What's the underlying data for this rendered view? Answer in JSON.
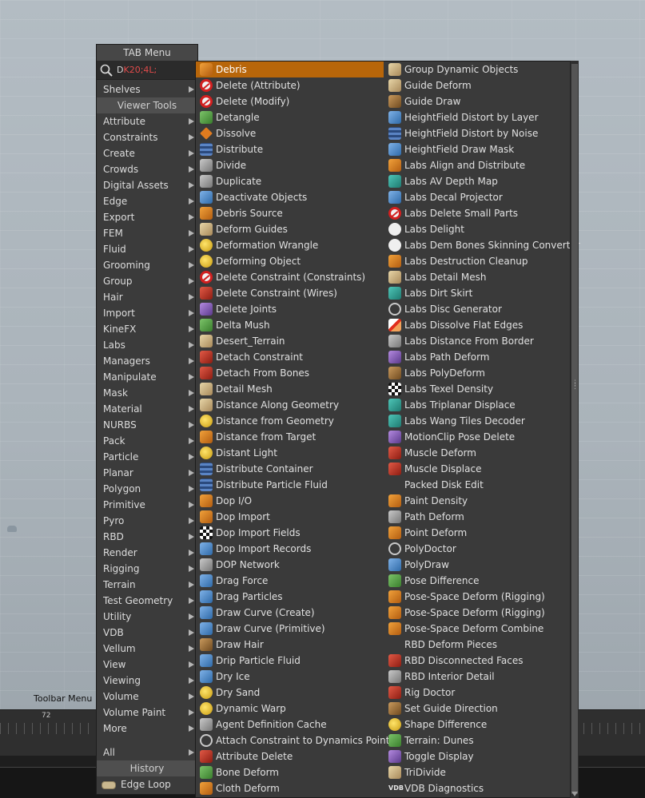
{
  "viewport": {
    "toolbar_menu_label": "Toolbar Menu",
    "frame_label": "72"
  },
  "tab_menu": {
    "title": "TAB Menu",
    "search": {
      "typed": "D",
      "hint": "K20;4L;"
    },
    "shelves_label": "Shelves",
    "viewer_tools_label": "Viewer Tools",
    "categories": [
      "Attribute",
      "Constraints",
      "Create",
      "Crowds",
      "Digital Assets",
      "Edge",
      "Export",
      "FEM",
      "Fluid",
      "Grooming",
      "Group",
      "Hair",
      "Import",
      "KineFX",
      "Labs",
      "Managers",
      "Manipulate",
      "Mask",
      "Material",
      "NURBS",
      "Pack",
      "Particle",
      "Planar",
      "Polygon",
      "Primitive",
      "Pyro",
      "RBD",
      "Render",
      "Rigging",
      "Terrain",
      "Test Geometry",
      "Utility",
      "VDB",
      "Vellum",
      "View",
      "Viewing",
      "Volume",
      "Volume Paint",
      "More"
    ],
    "all_label": "All",
    "history_label": "History",
    "history_items": [
      "Edge Loop"
    ]
  },
  "submenu": {
    "column1": [
      {
        "label": "Debris",
        "icon": "debris-icon",
        "style": "orange",
        "selected": true
      },
      {
        "label": "Delete (Attribute)",
        "icon": "no-entry-icon",
        "style": "noentry"
      },
      {
        "label": "Delete (Modify)",
        "icon": "no-entry-icon",
        "style": "noentry"
      },
      {
        "label": "Detangle",
        "icon": "detangle-icon",
        "style": "green"
      },
      {
        "label": "Dissolve",
        "icon": "dissolve-icon",
        "style": "diamond"
      },
      {
        "label": "Distribute",
        "icon": "distribute-icon",
        "style": "gridb"
      },
      {
        "label": "Divide",
        "icon": "divide-icon",
        "style": "grey"
      },
      {
        "label": "Duplicate",
        "icon": "duplicate-icon",
        "style": "grey"
      },
      {
        "label": "Deactivate Objects",
        "icon": "deactivate-objects-icon",
        "style": "blue"
      },
      {
        "label": "Debris Source",
        "icon": "debris-source-icon",
        "style": "orange"
      },
      {
        "label": "Deform Guides",
        "icon": "deform-guides-icon",
        "style": "tan"
      },
      {
        "label": "Deformation Wrangle",
        "icon": "wrangle-icon",
        "style": "yellow"
      },
      {
        "label": "Deforming Object",
        "icon": "deforming-object-icon",
        "style": "yellow"
      },
      {
        "label": "Delete Constraint (Constraints)",
        "icon": "no-entry-icon",
        "style": "noentry"
      },
      {
        "label": "Delete Constraint (Wires)",
        "icon": "delete-constraint-wires-icon",
        "style": "red"
      },
      {
        "label": "Delete Joints",
        "icon": "delete-joints-icon",
        "style": "purple"
      },
      {
        "label": "Delta Mush",
        "icon": "delta-mush-icon",
        "style": "green"
      },
      {
        "label": "Desert_Terrain",
        "icon": "desert-terrain-icon",
        "style": "tan"
      },
      {
        "label": "Detach Constraint",
        "icon": "detach-constraint-icon",
        "style": "red"
      },
      {
        "label": "Detach From Bones",
        "icon": "detach-from-bones-icon",
        "style": "red"
      },
      {
        "label": "Detail Mesh",
        "icon": "detail-mesh-icon",
        "style": "tan"
      },
      {
        "label": "Distance Along Geometry",
        "icon": "distance-along-geometry-icon",
        "style": "tan"
      },
      {
        "label": "Distance from Geometry",
        "icon": "distance-from-geometry-icon",
        "style": "yellow"
      },
      {
        "label": "Distance from Target",
        "icon": "distance-from-target-icon",
        "style": "orange"
      },
      {
        "label": "Distant Light",
        "icon": "distant-light-icon",
        "style": "yellow"
      },
      {
        "label": "Distribute Container",
        "icon": "distribute-container-icon",
        "style": "gridb"
      },
      {
        "label": "Distribute Particle Fluid",
        "icon": "distribute-particle-fluid-icon",
        "style": "gridb"
      },
      {
        "label": "Dop I/O",
        "icon": "dop-io-icon",
        "style": "orange"
      },
      {
        "label": "Dop Import",
        "icon": "dop-import-icon",
        "style": "orange"
      },
      {
        "label": "Dop Import Fields",
        "icon": "dop-import-fields-icon",
        "style": "checker"
      },
      {
        "label": "Dop Import Records",
        "icon": "dop-import-records-icon",
        "style": "blue"
      },
      {
        "label": "DOP Network",
        "icon": "dop-network-icon",
        "style": "grey"
      },
      {
        "label": "Drag Force",
        "icon": "drag-force-icon",
        "style": "blue"
      },
      {
        "label": "Drag Particles",
        "icon": "drag-particles-icon",
        "style": "blue"
      },
      {
        "label": "Draw Curve (Create)",
        "icon": "draw-curve-icon",
        "style": "blue"
      },
      {
        "label": "Draw Curve (Primitive)",
        "icon": "draw-curve-icon",
        "style": "blue"
      },
      {
        "label": "Draw Hair",
        "icon": "draw-hair-icon",
        "style": "brown"
      },
      {
        "label": "Drip Particle Fluid",
        "icon": "drip-particle-fluid-icon",
        "style": "blue"
      },
      {
        "label": "Dry Ice",
        "icon": "dry-ice-icon",
        "style": "blue"
      },
      {
        "label": "Dry Sand",
        "icon": "dry-sand-icon",
        "style": "yellow"
      },
      {
        "label": "Dynamic Warp",
        "icon": "dynamic-warp-icon",
        "style": "yellow"
      },
      {
        "label": "Agent Definition Cache",
        "icon": "agent-definition-cache-icon",
        "style": "grey"
      },
      {
        "label": "Attach Constraint to Dynamics Point",
        "icon": "attach-constraint-icon",
        "style": "ring"
      },
      {
        "label": "Attribute Delete",
        "icon": "attribute-delete-icon",
        "style": "red"
      },
      {
        "label": "Bone Deform",
        "icon": "bone-deform-icon",
        "style": "green"
      },
      {
        "label": "Cloth Deform",
        "icon": "cloth-deform-icon",
        "style": "orange"
      }
    ],
    "column2": [
      {
        "label": "Group Dynamic Objects",
        "icon": "group-dynamic-objects-icon",
        "style": "tan"
      },
      {
        "label": "Guide Deform",
        "icon": "guide-deform-icon",
        "style": "tan"
      },
      {
        "label": "Guide Draw",
        "icon": "guide-draw-icon",
        "style": "brown"
      },
      {
        "label": "HeightField Distort by Layer",
        "icon": "heightfield-distort-layer-icon",
        "style": "blue"
      },
      {
        "label": "HeightField Distort by Noise",
        "icon": "heightfield-distort-noise-icon",
        "style": "gridb"
      },
      {
        "label": "HeightField Draw Mask",
        "icon": "heightfield-draw-mask-icon",
        "style": "blue"
      },
      {
        "label": "Labs Align and Distribute",
        "icon": "labs-align-distribute-icon",
        "style": "orange"
      },
      {
        "label": "Labs AV Depth Map",
        "icon": "labs-av-depth-map-icon",
        "style": "teal"
      },
      {
        "label": "Labs Decal Projector",
        "icon": "labs-decal-projector-icon",
        "style": "blue"
      },
      {
        "label": "Labs Delete Small Parts",
        "icon": "no-entry-icon",
        "style": "noentry"
      },
      {
        "label": "Labs Delight",
        "icon": "labs-delight-icon",
        "style": "white"
      },
      {
        "label": "Labs Dem Bones Skinning Converter",
        "icon": "labs-dem-bones-icon",
        "style": "white"
      },
      {
        "label": "Labs Destruction Cleanup",
        "icon": "labs-destruction-cleanup-icon",
        "style": "orange"
      },
      {
        "label": "Labs Detail Mesh",
        "icon": "labs-detail-mesh-icon",
        "style": "tan"
      },
      {
        "label": "Labs Dirt Skirt",
        "icon": "labs-dirt-skirt-icon",
        "style": "teal"
      },
      {
        "label": "Labs Disc Generator",
        "icon": "labs-disc-generator-icon",
        "style": "ring"
      },
      {
        "label": "Labs Dissolve Flat Edges",
        "icon": "labs-dissolve-flat-edges-icon",
        "style": "diag"
      },
      {
        "label": "Labs Distance From Border",
        "icon": "labs-distance-from-border-icon",
        "style": "grey"
      },
      {
        "label": "Labs Path Deform",
        "icon": "labs-path-deform-icon",
        "style": "purple"
      },
      {
        "label": "Labs PolyDeform",
        "icon": "labs-polydeform-icon",
        "style": "brown"
      },
      {
        "label": "Labs Texel Density",
        "icon": "labs-texel-density-icon",
        "style": "checker"
      },
      {
        "label": "Labs Triplanar Displace",
        "icon": "labs-triplanar-displace-icon",
        "style": "teal"
      },
      {
        "label": "Labs Wang Tiles Decoder",
        "icon": "labs-wang-tiles-decoder-icon",
        "style": "teal"
      },
      {
        "label": "MotionClip Pose Delete",
        "icon": "motionclip-pose-delete-icon",
        "style": "purple"
      },
      {
        "label": "Muscle Deform",
        "icon": "muscle-deform-icon",
        "style": "red"
      },
      {
        "label": "Muscle Displace",
        "icon": "muscle-displace-icon",
        "style": "red"
      },
      {
        "label": "Packed Disk Edit",
        "icon": "packed-disk-edit-icon",
        "style": "none"
      },
      {
        "label": "Paint Density",
        "icon": "paint-density-icon",
        "style": "orange"
      },
      {
        "label": "Path Deform",
        "icon": "path-deform-icon",
        "style": "grey"
      },
      {
        "label": "Point Deform",
        "icon": "point-deform-icon",
        "style": "orange"
      },
      {
        "label": "PolyDoctor",
        "icon": "polydoctor-icon",
        "style": "ring"
      },
      {
        "label": "PolyDraw",
        "icon": "polydraw-icon",
        "style": "blue"
      },
      {
        "label": "Pose Difference",
        "icon": "pose-difference-icon",
        "style": "green"
      },
      {
        "label": "Pose-Space Deform (Rigging)",
        "icon": "pose-space-deform-icon",
        "style": "orange"
      },
      {
        "label": "Pose-Space Deform (Rigging)",
        "icon": "pose-space-deform-icon",
        "style": "orange"
      },
      {
        "label": "Pose-Space Deform Combine",
        "icon": "pose-space-deform-combine-icon",
        "style": "orange"
      },
      {
        "label": "RBD Deform Pieces",
        "icon": "rbd-deform-pieces-icon",
        "style": "none"
      },
      {
        "label": "RBD Disconnected Faces",
        "icon": "rbd-disconnected-faces-icon",
        "style": "red"
      },
      {
        "label": "RBD Interior Detail",
        "icon": "rbd-interior-detail-icon",
        "style": "grey"
      },
      {
        "label": "Rig Doctor",
        "icon": "rig-doctor-icon",
        "style": "red"
      },
      {
        "label": "Set Guide Direction",
        "icon": "set-guide-direction-icon",
        "style": "brown"
      },
      {
        "label": "Shape Difference",
        "icon": "shape-difference-icon",
        "style": "yellow"
      },
      {
        "label": "Terrain: Dunes",
        "icon": "terrain-dunes-icon",
        "style": "green"
      },
      {
        "label": "Toggle Display",
        "icon": "toggle-display-icon",
        "style": "purple"
      },
      {
        "label": "TriDivide",
        "icon": "tridivide-icon",
        "style": "tan"
      },
      {
        "label": "VDB Diagnostics",
        "icon": "vdb-icon",
        "style": "vdb",
        "icon_text": "VDB"
      }
    ]
  }
}
